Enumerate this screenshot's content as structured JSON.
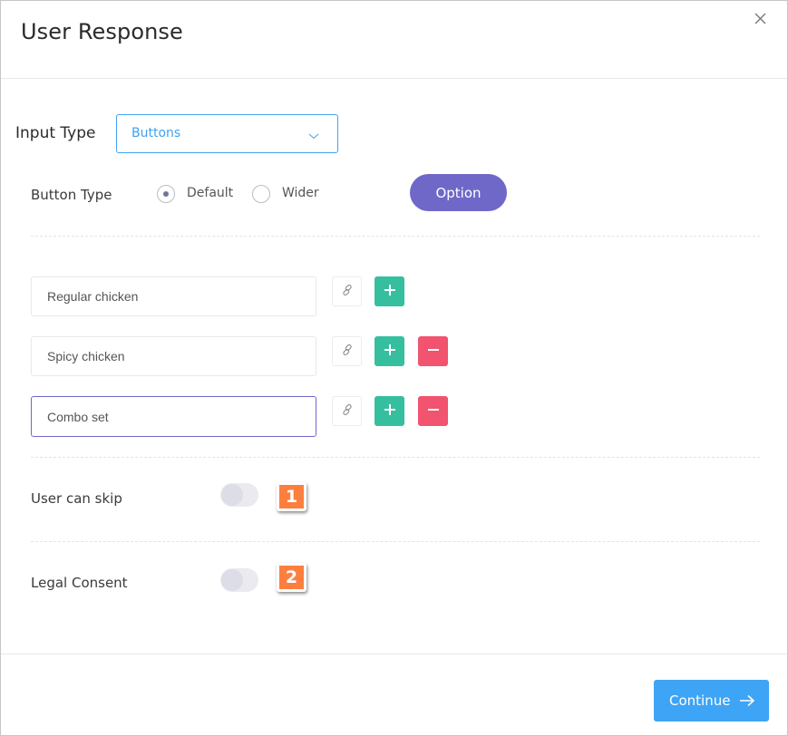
{
  "dialog": {
    "title": "User Response",
    "close_icon": "close-icon"
  },
  "input_type": {
    "label": "Input Type",
    "selected": "Buttons",
    "icon": "chevron-down-icon"
  },
  "button_type": {
    "label": "Button Type",
    "options": [
      {
        "label": "Default",
        "checked": true
      },
      {
        "label": "Wider",
        "checked": false
      }
    ],
    "option_button": "Option"
  },
  "options": [
    {
      "value": "Regular chicken",
      "has_remove": false,
      "active": false
    },
    {
      "value": "Spicy chicken",
      "has_remove": true,
      "active": false
    },
    {
      "value": "Combo set",
      "has_remove": true,
      "active": true
    }
  ],
  "option_icons": {
    "link": "link-icon",
    "add": "plus-icon",
    "remove": "minus-icon"
  },
  "settings": [
    {
      "label": "User can skip",
      "enabled": false,
      "badge": "1"
    },
    {
      "label": "Legal Consent",
      "enabled": false,
      "badge": "2"
    }
  ],
  "footer": {
    "continue_label": "Continue",
    "continue_icon": "arrow-right-icon"
  },
  "colors": {
    "primary_blue": "#3ea4f5",
    "purple": "#6f68c9",
    "add_green": "#35bf9e",
    "remove_red": "#f2536f",
    "badge_orange": "#fd7f3f"
  }
}
